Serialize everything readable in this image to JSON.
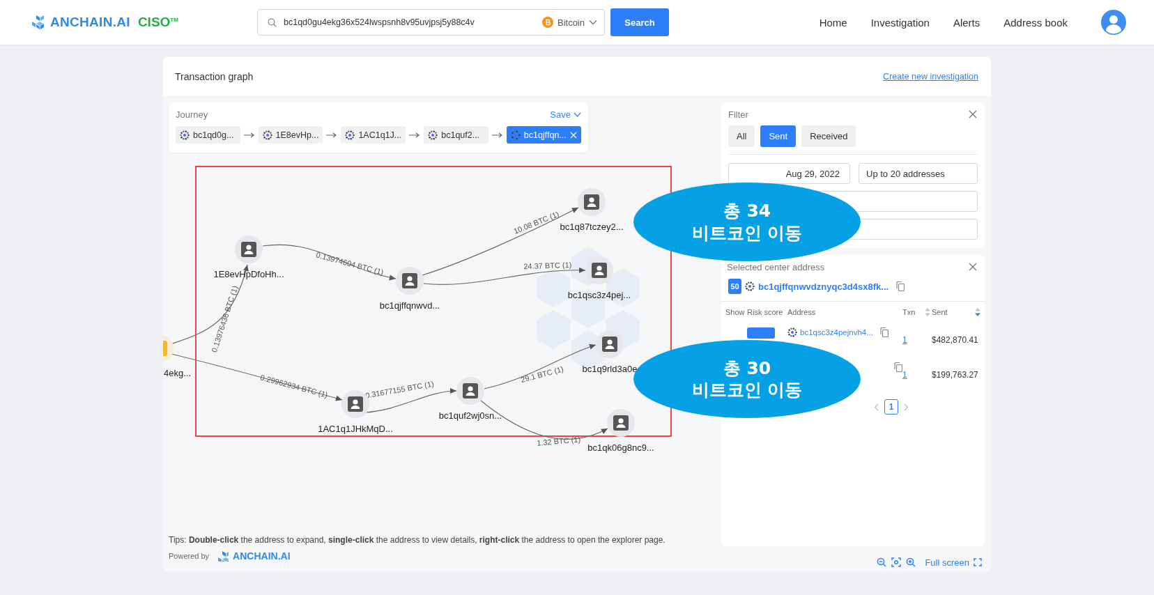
{
  "header": {
    "brand": "ANCHAIN.AI",
    "product": "CISO$^{TM}$",
    "search": {
      "value": "bc1qd0gu4ekg36x524lwspsnh8v95uvjpsj5y88c4v",
      "currency": "Bitcoin",
      "button": "Search"
    },
    "nav": [
      "Home",
      "Investigation",
      "Alerts",
      "Address book"
    ]
  },
  "card": {
    "title": "Transaction graph",
    "link": "Create new investigation"
  },
  "journey": {
    "title": "Journey",
    "save": "Save",
    "steps": [
      {
        "label": "bc1qd0g...",
        "selected": false
      },
      {
        "label": "1E8evHp...",
        "selected": false
      },
      {
        "label": "1AC1q1J...",
        "selected": false
      },
      {
        "label": "bc1quf2...",
        "selected": false
      },
      {
        "label": "bc1qjffqn...",
        "selected": true
      }
    ]
  },
  "graph": {
    "nodes": [
      {
        "label": "4ekg...",
        "kind": "source"
      },
      {
        "label": "1E8evHpDfoHh...",
        "kind": "wallet"
      },
      {
        "label": "bc1qjffqnwvd...",
        "kind": "wallet"
      },
      {
        "label": "bc1q87tczey2...",
        "kind": "wallet"
      },
      {
        "label": "bc1qsc3z4pej...",
        "kind": "wallet"
      },
      {
        "label": "bc1q9rld3a0e",
        "kind": "wallet"
      },
      {
        "label": "1AC1q1JHkMqD...",
        "kind": "wallet"
      },
      {
        "label": "bc1quf2wj0sn...",
        "kind": "wallet"
      },
      {
        "label": "bc1qk06g8nc9...",
        "kind": "wallet"
      }
    ],
    "edges": [
      {
        "label": "0.13976436 BTC (1)"
      },
      {
        "label": "0.13974604 BTC (1)"
      },
      {
        "label": "10.08 BTC (1)"
      },
      {
        "label": "24.37 BTC (1)"
      },
      {
        "label": "0.29962934 BTC (1)"
      },
      {
        "label": "0.31677155 BTC (1)"
      },
      {
        "label": "29.1 BTC (1)"
      },
      {
        "label": "1.32 BTC (1)"
      }
    ]
  },
  "annotations": {
    "frame": true,
    "callouts": [
      {
        "title": "총 34",
        "subtitle": "비트코인 이동"
      },
      {
        "title": "총 30",
        "subtitle": "비트코인 이동"
      }
    ]
  },
  "filter": {
    "title": "Filter",
    "tabs": [
      {
        "label": "All",
        "selected": false
      },
      {
        "label": "Sent",
        "selected": true
      },
      {
        "label": "Received",
        "selected": false
      }
    ],
    "date_range": "Aug 29, 2022",
    "limit": "Up to 20 addresses"
  },
  "center": {
    "title": "Selected center address",
    "score": "50",
    "address": "bc1qjffqnwvdznyqc3d4sx8fk...",
    "columns": [
      {
        "label": "Show"
      },
      {
        "label": "Risk score"
      },
      {
        "label": "Address"
      },
      {
        "label": "Txn",
        "sorted_desc": false
      },
      {
        "label": "Sent",
        "sorted_desc": true
      }
    ],
    "rows": [
      {
        "address": "bc1qsc3z4pejnvh4...",
        "txn": "1",
        "sent": "$482,870.41"
      },
      {
        "txn": "1",
        "sent": "$199,763.27"
      }
    ],
    "pages": [
      {
        "label": "1",
        "selected": true
      }
    ]
  },
  "footer": {
    "tips": "Tips: **Double-click** the address to expand, **single-click** the address to view details, **right-click** the address to open the explorer page.",
    "powered_by": "Powered by",
    "logo": "ANCHAIN.AI",
    "fullscreen": "Full screen"
  }
}
